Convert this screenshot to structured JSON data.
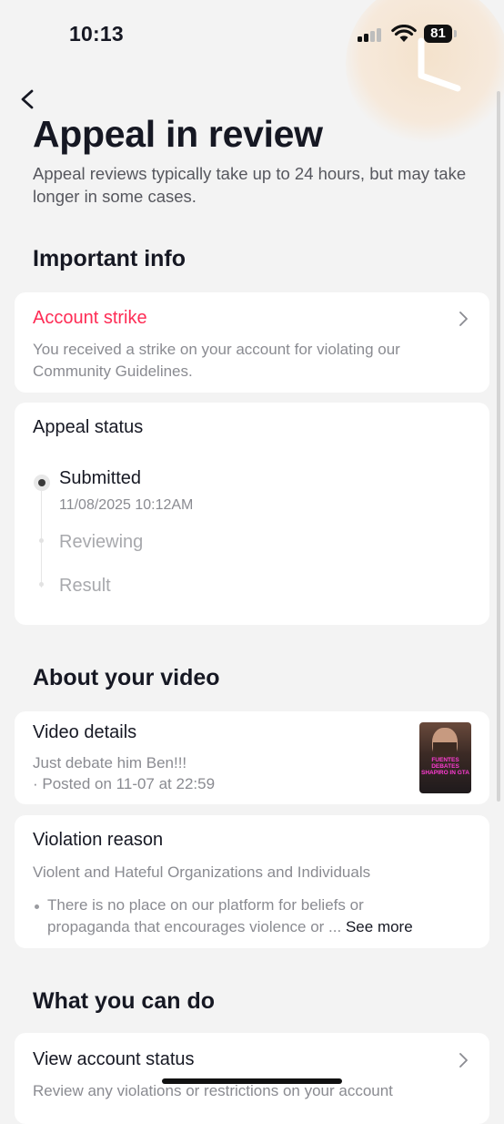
{
  "status_bar": {
    "time": "10:13",
    "battery": "81"
  },
  "header": {
    "title": "Appeal in review",
    "subtitle": "Appeal reviews typically take up to 24 hours, but may take longer in some cases."
  },
  "important_info": {
    "heading": "Important info",
    "strike": {
      "title": "Account strike",
      "description": "You received a strike on your account for violating our Community Guidelines."
    },
    "appeal_status": {
      "title": "Appeal status",
      "steps": [
        {
          "label": "Submitted",
          "date": "11/08/2025 10:12AM"
        },
        {
          "label": "Reviewing"
        },
        {
          "label": "Result"
        }
      ]
    }
  },
  "about_video": {
    "heading": "About your video",
    "details": {
      "title": "Video details",
      "caption": "Just debate him Ben!!!",
      "posted": "· Posted on 11-07 at 22:59",
      "thumbnail_text": "FUENTES DEBATES SHAPIRO IN GTA"
    },
    "violation": {
      "title": "Violation reason",
      "reason": "Violent and Hateful Organizations and Individuals",
      "bullet_line1": "There is no place on our platform for beliefs or",
      "bullet_line2": "propaganda that encourages violence or ...",
      "see_more": "See more"
    }
  },
  "what_you_can_do": {
    "heading": "What you can do",
    "account_status": {
      "title": "View account status",
      "description": "Review any violations or restrictions on your account"
    }
  },
  "icons": {
    "back": "chevron-left-icon",
    "row_chevron": "chevron-right-icon",
    "wifi": "wifi-icon",
    "signal": "signal-icon",
    "battery": "battery-icon"
  },
  "colors": {
    "accent": "#fe2c55",
    "background": "#f3f3f3",
    "card": "#ffffff"
  }
}
